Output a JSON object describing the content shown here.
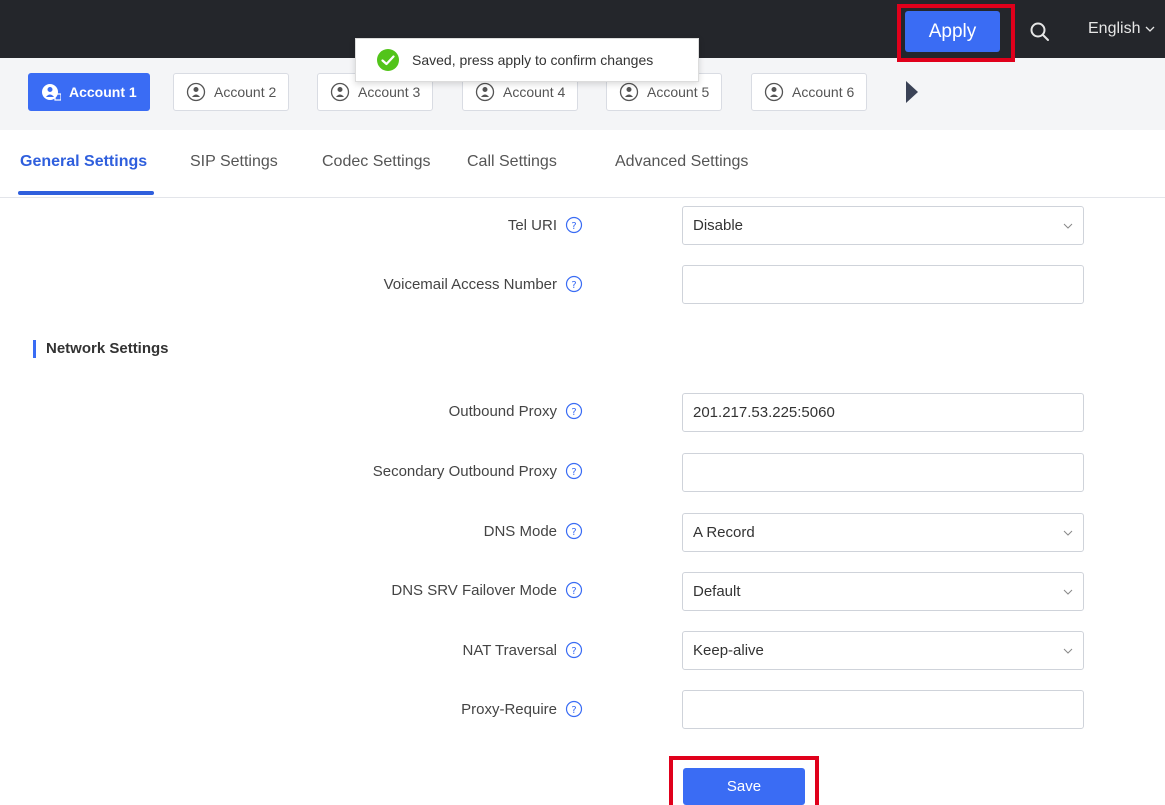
{
  "header": {
    "apply_label": "Apply",
    "language": "English",
    "accent_color": "#3a6cf4",
    "highlight_color": "#e0001b"
  },
  "toast": {
    "message": "Saved, press apply to confirm changes"
  },
  "accounts": [
    {
      "label": "Account 1",
      "active": true
    },
    {
      "label": "Account 2",
      "active": false
    },
    {
      "label": "Account 3",
      "active": false
    },
    {
      "label": "Account 4",
      "active": false
    },
    {
      "label": "Account 5",
      "active": false
    },
    {
      "label": "Account 6",
      "active": false
    }
  ],
  "subtabs": [
    {
      "label": "General Settings",
      "active": true
    },
    {
      "label": "SIP Settings",
      "active": false
    },
    {
      "label": "Codec Settings",
      "active": false
    },
    {
      "label": "Call Settings",
      "active": false
    },
    {
      "label": "Advanced Settings",
      "active": false
    }
  ],
  "form": {
    "tel_uri": {
      "label": "Tel URI",
      "value": "Disable",
      "type": "select"
    },
    "voicemail": {
      "label": "Voicemail Access Number",
      "value": "",
      "type": "text"
    },
    "section_network": "Network Settings",
    "outbound_proxy": {
      "label": "Outbound Proxy",
      "value": "201.217.53.225:5060",
      "type": "text"
    },
    "secondary_outbound_proxy": {
      "label": "Secondary Outbound Proxy",
      "value": "",
      "type": "text"
    },
    "dns_mode": {
      "label": "DNS Mode",
      "value": "A Record",
      "type": "select"
    },
    "dns_srv_failover": {
      "label": "DNS SRV Failover Mode",
      "value": "Default",
      "type": "select"
    },
    "nat_traversal": {
      "label": "NAT Traversal",
      "value": "Keep-alive",
      "type": "select"
    },
    "proxy_require": {
      "label": "Proxy-Require",
      "value": "",
      "type": "text"
    }
  },
  "footer": {
    "save_label": "Save"
  }
}
